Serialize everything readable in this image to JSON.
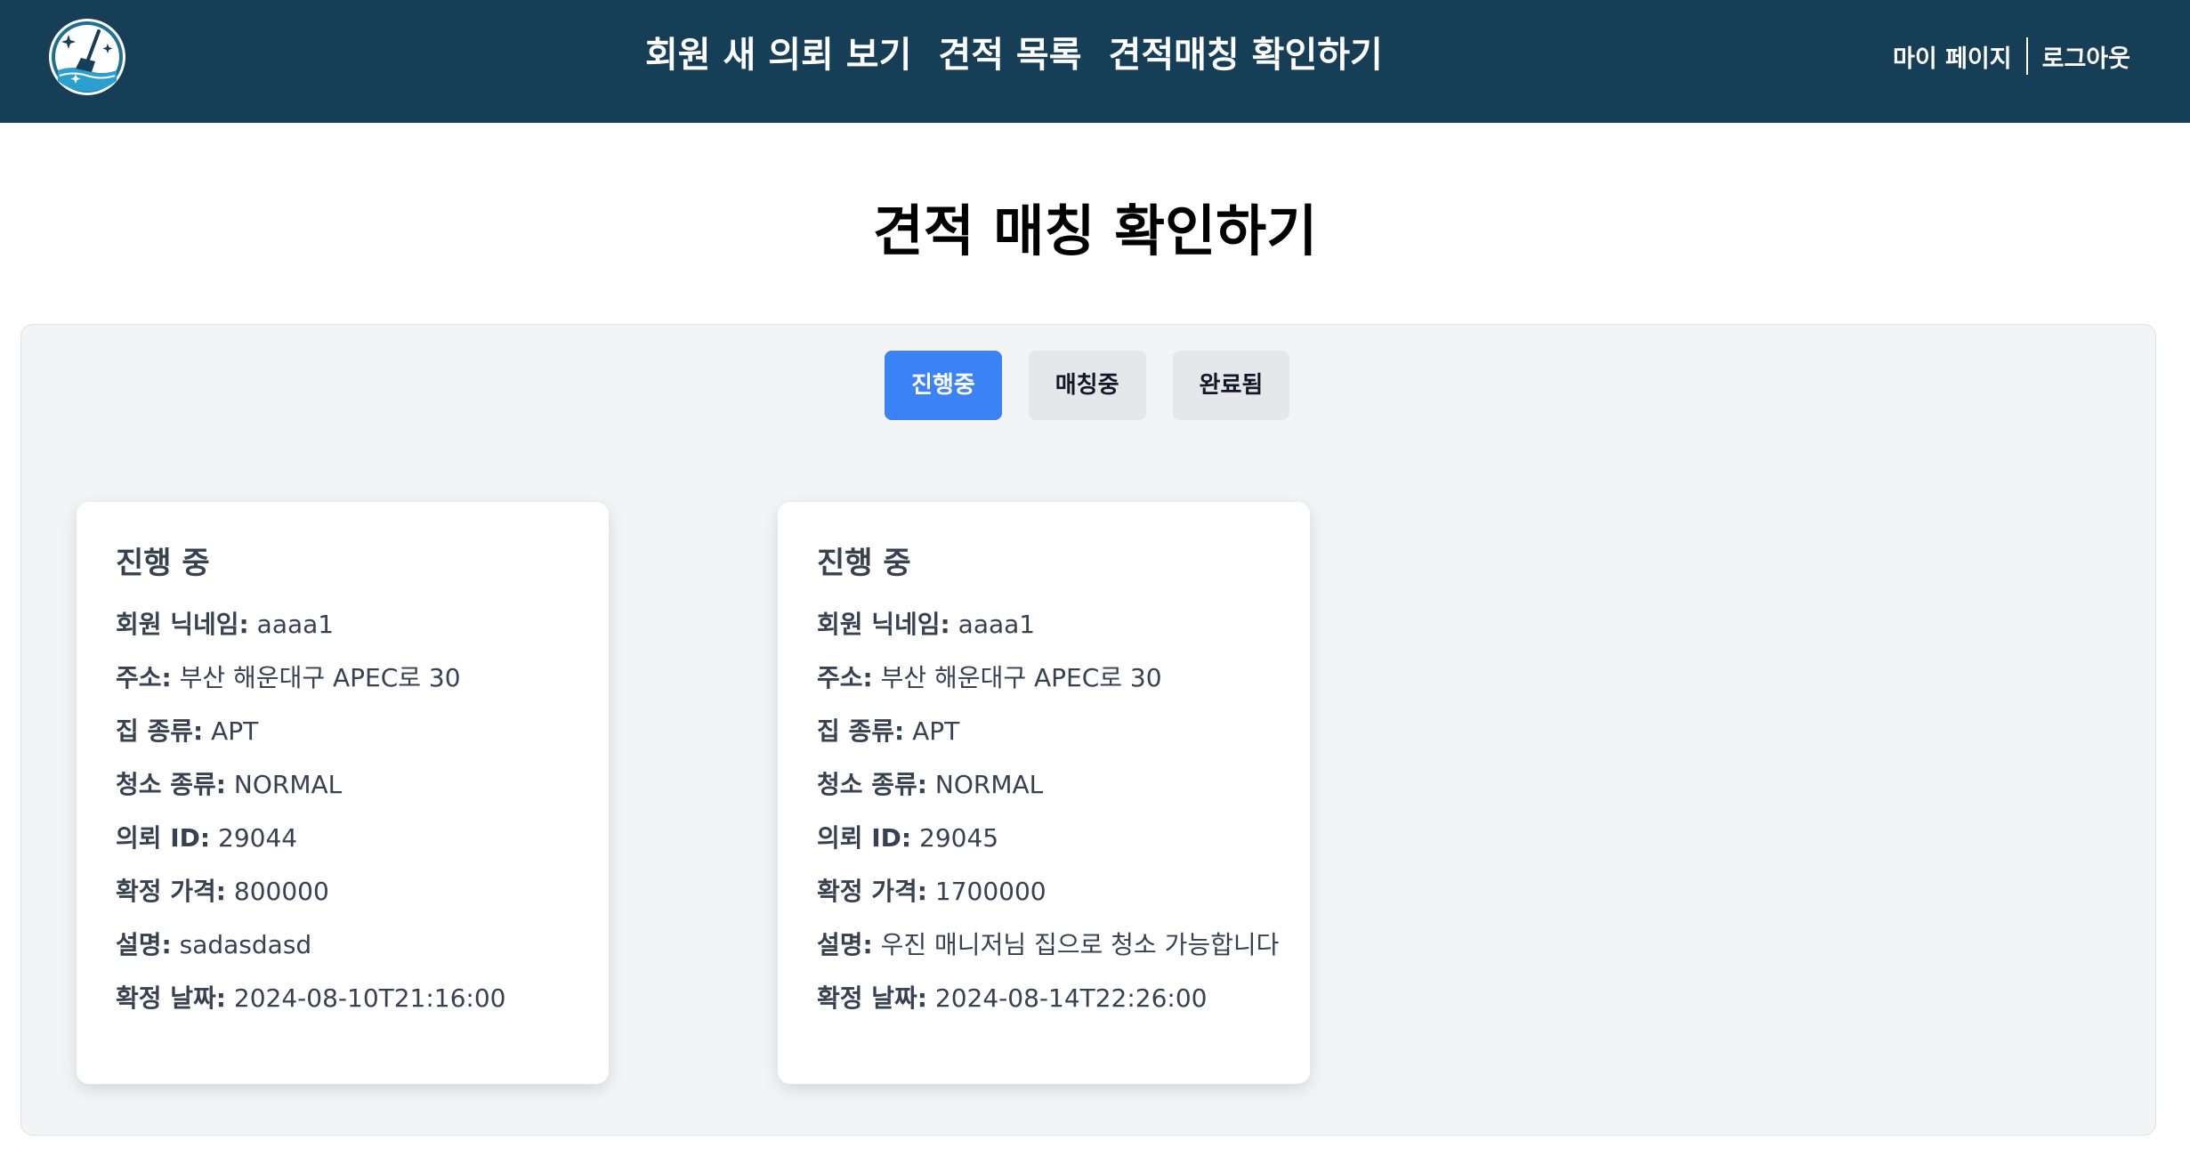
{
  "colors": {
    "header_bg": "#163e56",
    "panel_bg": "#f3f4f6",
    "tab_active": "#3b82f6",
    "tab_inactive": "#e5e7eb"
  },
  "header": {
    "logo_icon": "cleaning-broom-icon",
    "nav": [
      {
        "label": "회원 새 의뢰 보기"
      },
      {
        "label": "견적 목록"
      },
      {
        "label": "견적매칭 확인하기"
      }
    ],
    "user_menu": {
      "mypage": "마이 페이지",
      "logout": "로그아웃"
    }
  },
  "page": {
    "title": "견적 매칭 확인하기"
  },
  "tabs": [
    {
      "label": "진행중",
      "active": true
    },
    {
      "label": "매칭중",
      "active": false
    },
    {
      "label": "완료됨",
      "active": false
    }
  ],
  "cards": [
    {
      "status": "진행 중",
      "rows": [
        {
          "label": "회원 닉네임:",
          "value": "aaaa1"
        },
        {
          "label": "주소:",
          "value": "부산 해운대구 APEC로 30"
        },
        {
          "label": "집 종류:",
          "value": "APT"
        },
        {
          "label": "청소 종류:",
          "value": "NORMAL"
        },
        {
          "label": "의뢰 ID:",
          "value": "29044"
        },
        {
          "label": "확정 가격:",
          "value": "800000"
        },
        {
          "label": "설명:",
          "value": "sadasdasd"
        },
        {
          "label": "확정 날짜:",
          "value": "2024-08-10T21:16:00"
        }
      ]
    },
    {
      "status": "진행 중",
      "rows": [
        {
          "label": "회원 닉네임:",
          "value": "aaaa1"
        },
        {
          "label": "주소:",
          "value": "부산 해운대구 APEC로 30"
        },
        {
          "label": "집 종류:",
          "value": "APT"
        },
        {
          "label": "청소 종류:",
          "value": "NORMAL"
        },
        {
          "label": "의뢰 ID:",
          "value": "29045"
        },
        {
          "label": "확정 가격:",
          "value": "1700000"
        },
        {
          "label": "설명:",
          "value": "우진 매니저님 집으로 청소 가능합니다"
        },
        {
          "label": "확정 날짜:",
          "value": "2024-08-14T22:26:00"
        }
      ]
    }
  ]
}
